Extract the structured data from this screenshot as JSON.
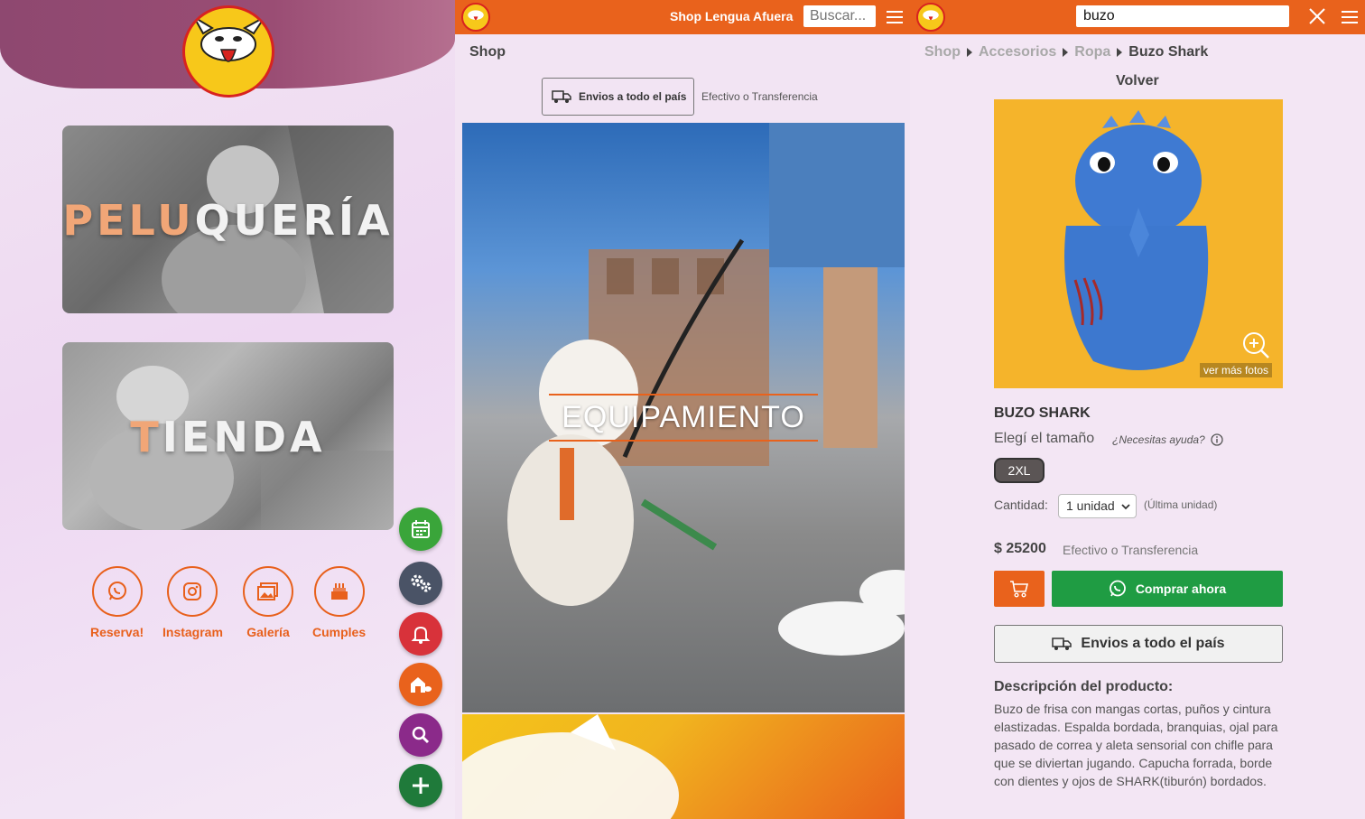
{
  "home": {
    "logo_text": "LenguAfuera",
    "cards": [
      {
        "label_highlight": "PELU",
        "label_rest": "QUERÍA"
      },
      {
        "label_highlight": "T",
        "label_rest": "IENDA"
      }
    ],
    "social": [
      {
        "label": "Reserva!",
        "icon": "whatsapp-icon"
      },
      {
        "label": "Instagram",
        "icon": "instagram-icon"
      },
      {
        "label": "Galería",
        "icon": "gallery-icon"
      },
      {
        "label": "Cumples",
        "icon": "cake-icon"
      }
    ],
    "fabs": [
      {
        "icon": "calendar-icon",
        "color": "#3aa53a"
      },
      {
        "icon": "gears-icon",
        "color": "#4a5366"
      },
      {
        "icon": "bell-icon",
        "color": "#d8323a"
      },
      {
        "icon": "dog-house-icon",
        "color": "#e9621c"
      },
      {
        "icon": "search-icon",
        "color": "#8b2a8a"
      },
      {
        "icon": "plus-icon",
        "color": "#1f7a3a"
      }
    ],
    "colors": {
      "header": "#8e4870",
      "accent": "#e8601c"
    }
  },
  "shop": {
    "header_title": "Shop Lengua Afuera",
    "search_placeholder": "Buscar...",
    "title": "Shop",
    "shipping_label": "Envios a todo el país",
    "payment_text": "Efectivo o Transferencia",
    "category_label": "EQUIPAMIENTO"
  },
  "product": {
    "search_value": "buzo",
    "breadcrumb": [
      "Shop",
      "Accesorios",
      "Ropa"
    ],
    "breadcrumb_current": "Buzo Shark",
    "back_label": "Volver",
    "more_photos_label": "ver más fotos",
    "name": "BUZO SHARK",
    "size_label": "Elegí el tamaño",
    "help_text": "¿Necesitas ayuda?",
    "size_selected": "2XL",
    "qty_label": "Cantidad:",
    "qty_value": "1 unidad",
    "qty_note": "(Última unidad)",
    "price": "$ 25200",
    "price_note": "Efectivo o Transferencia",
    "buy_label": "Comprar ahora",
    "shipping_label": "Envios a todo el país",
    "description_title": "Descripción del producto:",
    "description": "Buzo de frisa con mangas cortas, puños y cintura elastizadas. Espalda bordada, branquias, ojal para pasado de correa y aleta sensorial con chifle para que se diviertan jugando. Capucha forrada, borde con dientes y ojos de SHARK(tiburón) bordados.",
    "colors": {
      "buy": "#1f9c43",
      "cart": "#e9621c",
      "topbar": "#e9621c"
    }
  }
}
